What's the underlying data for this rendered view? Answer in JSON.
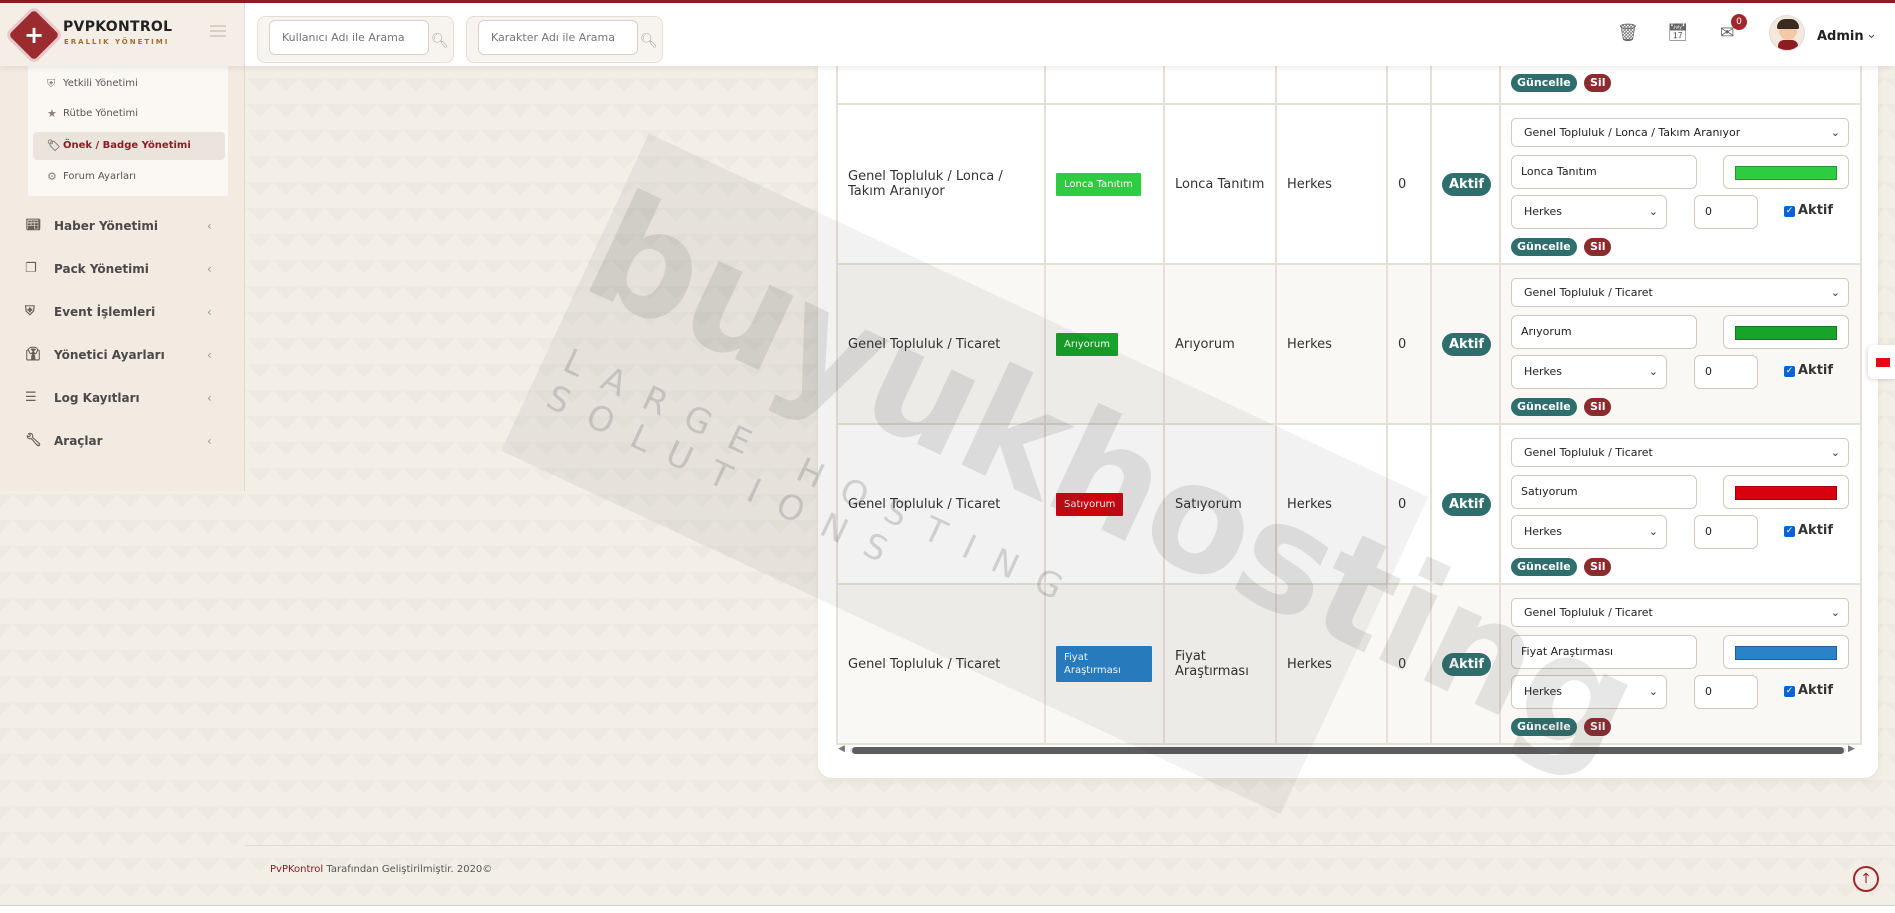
{
  "app": {
    "title": "PVPKONTROL",
    "subtitle": "ERALLIK YÖNETIMI"
  },
  "header": {
    "search_user_placeholder": "Kullanıcı Adı ile Arama",
    "search_char_placeholder": "Karakter Adı ile Arama",
    "notification_count": "0",
    "admin_name": "Admin"
  },
  "sidebar": {
    "subitems": [
      {
        "label": "Yetkili Yönetimi",
        "icon": "shield-icon"
      },
      {
        "label": "Rütbe Yönetimi",
        "icon": "star-icon"
      },
      {
        "label": "Önek / Badge Yönetimi",
        "icon": "tags-icon",
        "active": true
      },
      {
        "label": "Forum Ayarları",
        "icon": "cogs-icon"
      }
    ],
    "items": [
      {
        "label": "Haber Yönetimi",
        "icon": "newspaper-icon"
      },
      {
        "label": "Pack Yönetimi",
        "icon": "clone-icon"
      },
      {
        "label": "Event İşlemleri",
        "icon": "shield-icon"
      },
      {
        "label": "Yönetici Ayarları",
        "icon": "user-tie-icon"
      },
      {
        "label": "Log Kayıtları",
        "icon": "bars-icon"
      },
      {
        "label": "Araçlar",
        "icon": "wrench-icon"
      }
    ]
  },
  "table": {
    "buttons": {
      "update": "Güncelle",
      "delete": "Sil"
    },
    "checkbox_label": "Aktif",
    "rows": [
      {
        "category": "Genel Topluluk / Lonca / Takım Aranıyor",
        "badge_text": "Lonca Tanıtım",
        "badge_color": "#2ecc40",
        "name": "Lonca Tanıtım",
        "audience": "Herkes",
        "order": "0",
        "status": "Aktif",
        "form": {
          "category": "Genel Topluluk / Lonca / Takım Aranıyor",
          "name": "Lonca Tanıtım",
          "color": "#2ecc40",
          "audience": "Herkes",
          "order": "0"
        }
      },
      {
        "category": "Genel Topluluk / Ticaret",
        "badge_text": "Arıyorum",
        "badge_color": "#18a32a",
        "name": "Arıyorum",
        "audience": "Herkes",
        "order": "0",
        "status": "Aktif",
        "form": {
          "category": "Genel Topluluk / Ticaret",
          "name": "Arıyorum",
          "color": "#18a32a",
          "audience": "Herkes",
          "order": "0"
        }
      },
      {
        "category": "Genel Topluluk / Ticaret",
        "badge_text": "Satıyorum",
        "badge_color": "#d9000f",
        "name": "Satıyorum",
        "audience": "Herkes",
        "order": "0",
        "status": "Aktif",
        "form": {
          "category": "Genel Topluluk / Ticaret",
          "name": "Satıyorum",
          "color": "#d9000f",
          "audience": "Herkes",
          "order": "0"
        }
      },
      {
        "category": "Genel Topluluk / Ticaret",
        "badge_text": "Fiyat Araştırması",
        "badge_color": "#2a82c8",
        "name": "Fiyat Araştırması",
        "audience": "Herkes",
        "order": "0",
        "status": "Aktif",
        "form": {
          "category": "Genel Topluluk / Ticaret",
          "name": "Fiyat Araştırması",
          "color": "#2a82c8",
          "audience": "Herkes",
          "order": "0"
        }
      }
    ]
  },
  "watermark": {
    "main": "buyukhosting",
    "sub": "LARGE HOSTING SOLUTIONS"
  },
  "footer": {
    "brand": "PvPKontrol",
    "text": " Tarafından Geliştirilmiştir. 2020©"
  },
  "colors": {
    "brand_red": "#8b1d22",
    "button_teal": "#2e6f6e",
    "button_delete": "#8c2a2e"
  }
}
